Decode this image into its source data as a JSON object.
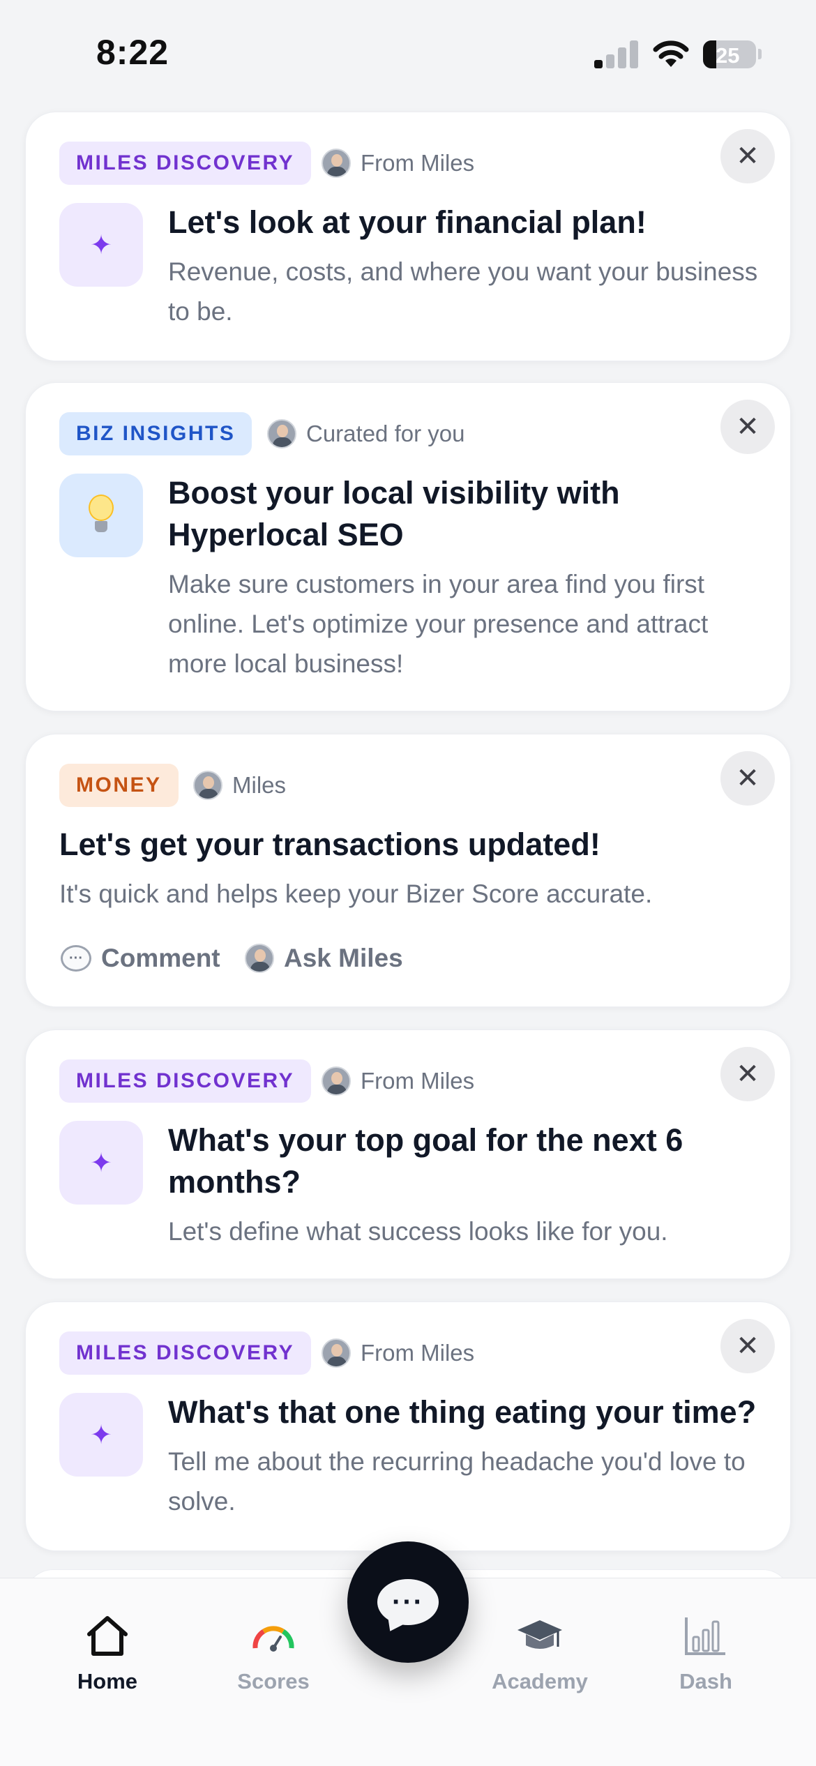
{
  "status_bar": {
    "time": "8:22",
    "battery": "25"
  },
  "cards": [
    {
      "tag": "MILES DISCOVERY",
      "source": "From Miles",
      "title": "Let's look at your financial plan!",
      "description": "Revenue, costs, and where you want your business to be.",
      "icon": "sparkle-icon"
    },
    {
      "tag": "BIZ INSIGHTS",
      "source": "Curated for you",
      "title": "Boost your local visibility with Hyperlocal SEO",
      "description": "Make sure customers in your area find you first online. Let's optimize your presence and attract more local business!",
      "icon": "lightbulb-icon"
    },
    {
      "tag": "MONEY",
      "source": "Miles",
      "title": "Let's get your transactions updated!",
      "description": "It's quick and helps keep your Bizer Score accurate.",
      "actions": {
        "comment": "Comment",
        "ask": "Ask Miles"
      }
    },
    {
      "tag": "MILES DISCOVERY",
      "source": "From Miles",
      "title": "What's your top goal for the next 6 months?",
      "description": "Let's define what success looks like for you.",
      "icon": "sparkle-icon"
    },
    {
      "tag": "MILES DISCOVERY",
      "source": "From Miles",
      "title": "What's that one thing eating your time?",
      "description": "Tell me about the recurring headache you'd love to solve.",
      "icon": "sparkle-icon"
    }
  ],
  "close_glyph": "✕",
  "sparkle_glyph": "✦",
  "tab_bar": {
    "tabs": [
      {
        "label": "Home",
        "icon": "home-icon",
        "active": true
      },
      {
        "label": "Scores",
        "icon": "gauge-icon",
        "active": false
      },
      {
        "label": "Academy",
        "icon": "graduation-cap-icon",
        "active": false
      },
      {
        "label": "Dash",
        "icon": "bar-chart-icon",
        "active": false
      }
    ],
    "fab_icon": "chat-bubble-icon",
    "fab_glyph": "···"
  },
  "colors": {
    "purple_tag": "#7132cf",
    "blue_tag": "#1f55c7",
    "orange_tag": "#c55313",
    "fab": "#0b0f19"
  }
}
